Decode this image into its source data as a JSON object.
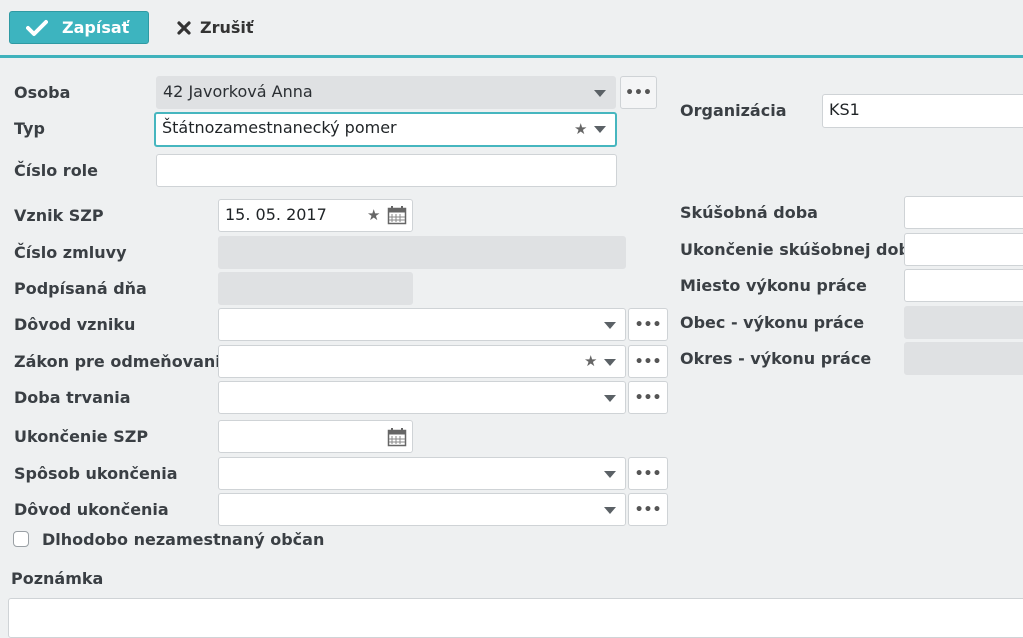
{
  "toolbar": {
    "save_label": "Zapísať",
    "cancel_label": "Zrušiť"
  },
  "form": {
    "osoba": {
      "label": "Osoba",
      "value": "42 Javorková Anna"
    },
    "typ": {
      "label": "Typ",
      "value": "Štátnozamestnanecký pomer"
    },
    "cislo_role": {
      "label": "Číslo role",
      "value": ""
    },
    "vznik_szp": {
      "label": "Vznik SZP",
      "value": "15. 05. 2017"
    },
    "cislo_zmluvy": {
      "label": "Číslo zmluvy",
      "value": ""
    },
    "podpisana_dna": {
      "label": "Podpísaná dňa",
      "value": ""
    },
    "dovod_vzniku": {
      "label": "Dôvod vzniku",
      "value": ""
    },
    "zakon": {
      "label": "Zákon pre odmeňovanie",
      "value": ""
    },
    "doba_trvania": {
      "label": "Doba trvania",
      "value": ""
    },
    "ukoncenie_szp": {
      "label": "Ukončenie SZP",
      "value": ""
    },
    "sposob_ukoncenia": {
      "label": "Spôsob ukončenia",
      "value": ""
    },
    "dovod_ukoncenia": {
      "label": "Dôvod ukončenia",
      "value": ""
    },
    "dlhodobo": {
      "label": "Dlhodobo nezamestnaný občan",
      "checked": false
    },
    "poznamka": {
      "label": "Poznámka",
      "value": ""
    },
    "organizacia": {
      "label": "Organizácia",
      "value": "KS1"
    },
    "skusobna_doba": {
      "label": "Skúšobná doba",
      "value": ""
    },
    "ukoncenie_skusobnej": {
      "label": "Ukončenie skúšobnej doby",
      "value": ""
    },
    "miesto_vykonu": {
      "label": "Miesto výkonu práce",
      "value": ""
    },
    "obec_vykonu": {
      "label": "Obec - výkonu práce",
      "value": ""
    },
    "okres_vykonu": {
      "label": "Okres - výkonu práce",
      "value": ""
    }
  },
  "colors": {
    "accent": "#3db4bf",
    "disabled": "#dfe1e3",
    "background": "#eef0f1"
  },
  "icons": {
    "more": "ellipsis-icon",
    "dropdown": "chevron-down-icon",
    "favorite": "star-icon",
    "calendar": "calendar-icon"
  }
}
